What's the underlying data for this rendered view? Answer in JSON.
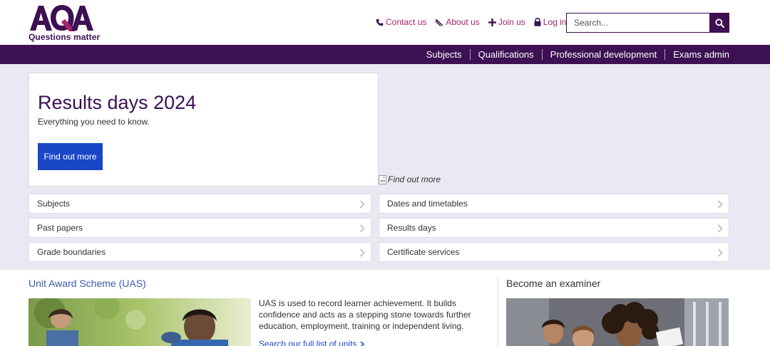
{
  "brand": {
    "name": "AQA",
    "tagline": "Questions matter",
    "color_primary": "#3c1053",
    "color_accent": "#a6246c",
    "color_button": "#1a47c7"
  },
  "utility_nav": [
    {
      "label": "Contact us",
      "icon": "phone-icon"
    },
    {
      "label": "About us",
      "icon": "megaphone-icon"
    },
    {
      "label": "Join us",
      "icon": "plus-icon"
    },
    {
      "label": "Log in",
      "icon": "lock-icon"
    }
  ],
  "search": {
    "placeholder": "Search...",
    "icon": "search-icon"
  },
  "main_nav": [
    "Subjects",
    "Qualifications",
    "Professional development",
    "Exams admin"
  ],
  "hero": {
    "title": "Results days 2024",
    "subtitle": "Everything you need to know.",
    "button_label": "Find out more",
    "image_alt": "Find out more"
  },
  "quick_links": {
    "left": [
      "Subjects",
      "Past papers",
      "Grade boundaries"
    ],
    "right": [
      "Dates and timetables",
      "Results days",
      "Certificate services"
    ]
  },
  "uas": {
    "title": "Unit Award Scheme (UAS)",
    "description": "UAS is used to record learner achievement. It builds confidence and acts as a stepping stone towards further education, employment, training or independent living.",
    "link": "Search our full list of units"
  },
  "examiner": {
    "title": "Become an examiner"
  }
}
